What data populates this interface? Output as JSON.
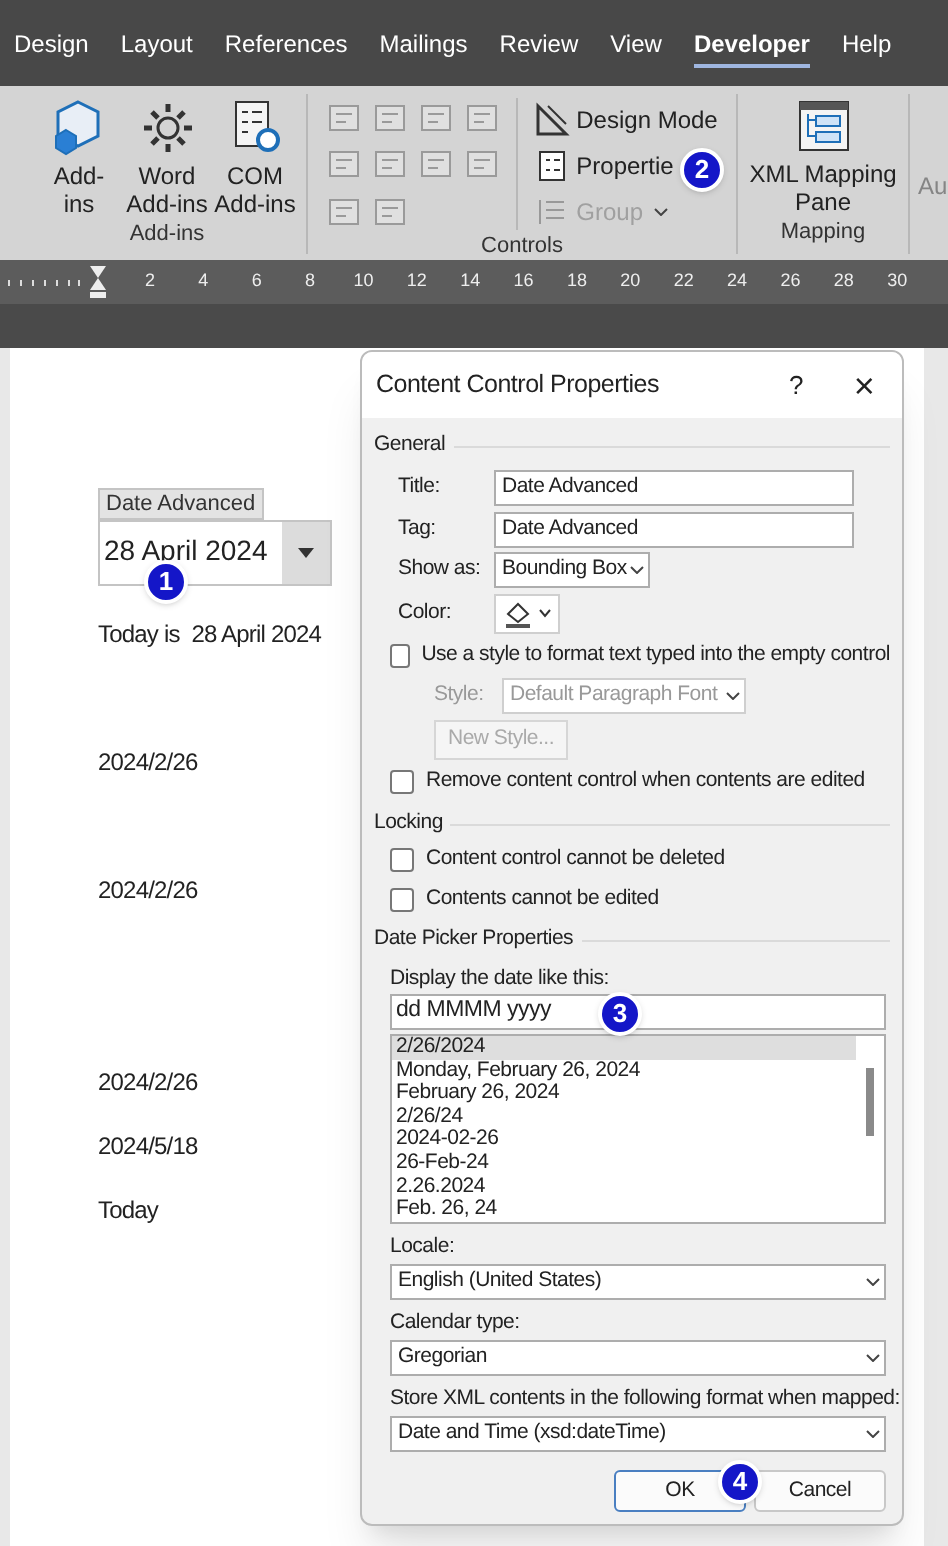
{
  "ribbon_tabs": [
    {
      "label": "Design",
      "selected": false
    },
    {
      "label": "Layout",
      "selected": false
    },
    {
      "label": "References",
      "selected": false
    },
    {
      "label": "Mailings",
      "selected": false
    },
    {
      "label": "Review",
      "selected": false
    },
    {
      "label": "View",
      "selected": false
    },
    {
      "label": "Developer",
      "selected": true
    },
    {
      "label": "Help",
      "selected": false
    }
  ],
  "addins_group": {
    "label": "Add-ins",
    "buttons": [
      [
        "Add-",
        "ins"
      ],
      [
        "Word",
        "Add-ins"
      ],
      [
        "COM",
        "Add-ins"
      ]
    ]
  },
  "controls_group": {
    "label": "Controls",
    "commands": [
      {
        "label": "Design Mode",
        "disabled": false
      },
      {
        "label": "Propertie",
        "disabled": false
      },
      {
        "label": "Group",
        "disabled": true
      }
    ]
  },
  "mapping_group": {
    "label": "Mapping",
    "button": [
      "XML Mapping",
      "Pane"
    ]
  },
  "ribbon_cut_label": "Au",
  "ruler_numbers": [
    "2",
    "4",
    "6",
    "8",
    "10",
    "12",
    "14",
    "16",
    "18",
    "20",
    "22",
    "24",
    "26",
    "28",
    "30"
  ],
  "document": {
    "control_title": "Date Advanced",
    "control_value": "28 April 2024",
    "lines": [
      "Today is  28 April 2024",
      "2024/2/26",
      "2024/2/26",
      "2024/2/26",
      "2024/5/18",
      "Today"
    ]
  },
  "dialog": {
    "title": "Content Control Properties",
    "help": "?",
    "close": "×",
    "general": {
      "heading": "General",
      "title_label": "Title:",
      "title_value": "Date Advanced",
      "tag_label": "Tag:",
      "tag_value": "Date Advanced",
      "show_as_label": "Show as:",
      "show_as_value": "Bounding Box",
      "color_label": "Color:",
      "use_style": {
        "label": "Use a style to format text typed into the empty control",
        "checked": false
      },
      "style_label": "Style:",
      "style_value": "Default Paragraph Font",
      "style_disabled": true,
      "new_style": "New Style...",
      "remove": {
        "label": "Remove content control when contents are edited",
        "checked": false
      }
    },
    "locking": {
      "heading": "Locking",
      "options": [
        {
          "label": "Content control cannot be deleted",
          "checked": false
        },
        {
          "label": "Contents cannot be edited",
          "checked": false
        }
      ]
    },
    "date_picker": {
      "heading": "Date Picker Properties",
      "format_label": "Display the date like this:",
      "format_value": "dd MMMM yyyy",
      "formats": [
        {
          "label": "2/26/2024",
          "selected": true
        },
        {
          "label": "Monday, February 26, 2024",
          "selected": false
        },
        {
          "label": "February 26, 2024",
          "selected": false
        },
        {
          "label": "2/26/24",
          "selected": false
        },
        {
          "label": "2024-02-26",
          "selected": false
        },
        {
          "label": "26-Feb-24",
          "selected": false
        },
        {
          "label": "2.26.2024",
          "selected": false
        },
        {
          "label": "Feb. 26, 24",
          "selected": false
        }
      ],
      "locale_label": "Locale:",
      "locale_value": "English (United States)",
      "calendar_label": "Calendar type:",
      "calendar_value": "Gregorian",
      "xml_label": "Store XML contents in the following format when mapped:",
      "xml_value": "Date and Time (xsd:dateTime)"
    },
    "buttons": [
      {
        "label": "OK",
        "default": true
      },
      {
        "label": "Cancel",
        "default": false
      }
    ]
  },
  "callouts": [
    "1",
    "2",
    "3",
    "4"
  ]
}
